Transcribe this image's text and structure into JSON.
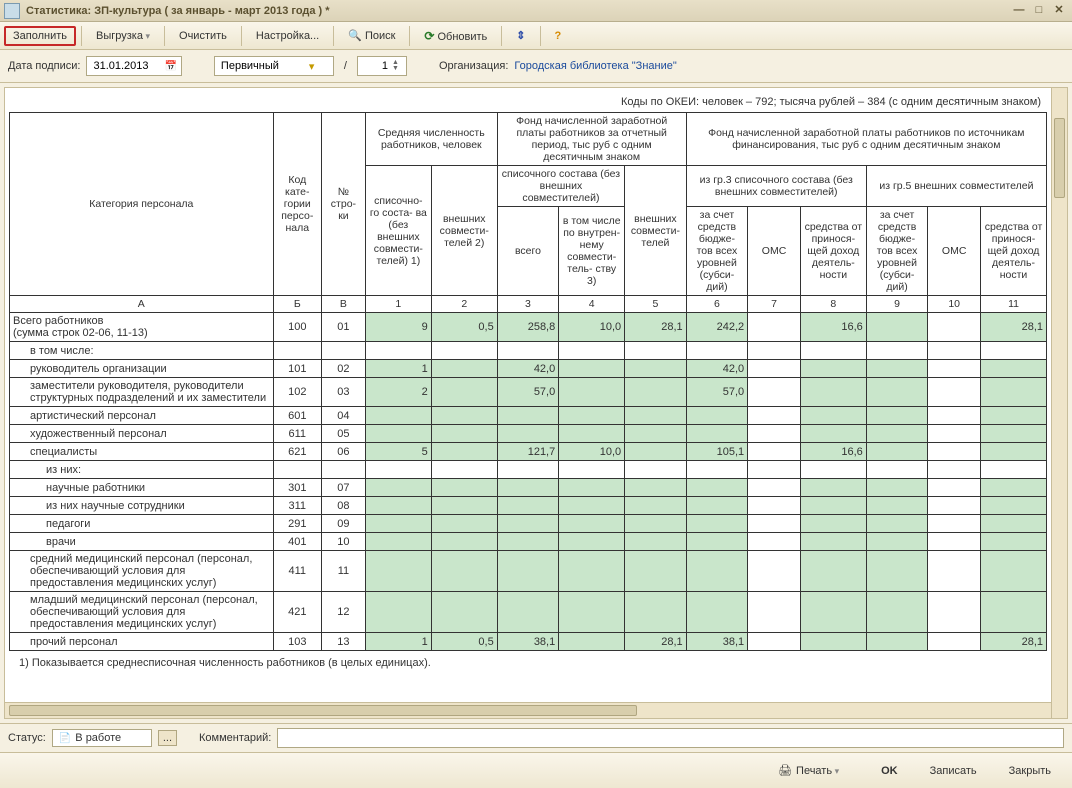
{
  "title": "Статистика: ЗП-культура ( за январь - март 2013 года ) *",
  "toolbar": {
    "fill": "Заполнить",
    "export": "Выгрузка",
    "clear": "Очистить",
    "settings": "Настройка...",
    "search": "Поиск",
    "refresh": "Обновить"
  },
  "params": {
    "dateLabel": "Дата подписи:",
    "dateValue": "31.01.2013",
    "typeValue": "Первичный",
    "numValue": "1",
    "orgLabel": "Организация:",
    "orgValue": "Городская библиотека \"Знание\""
  },
  "okei": "Коды по ОКЕИ: человек – 792; тысяча рублей – 384 (с одним десятичным знаком)",
  "headers": {
    "cat": "Категория персонала",
    "code": "Код кате-\nгории персо-\nнала",
    "rownum": "№ стро-\nки",
    "avg": "Средняя численность работников, человек",
    "fund1": "Фонд начисленной заработной платы работников за отчетный период, тыс руб\nс одним десятичным знаком",
    "fund2": "Фонд начисленной заработной платы работников по источникам финансирования, тыс руб с одним десятичным знаком",
    "col1": "списочно-\nго соста-\nва (без внешних совмести-\nтелей) 1)",
    "col2": "внешних совмести-\nтелей 2)",
    "col3g": "списочного состава (без внешних совместителей)",
    "col3": "всего",
    "col4": "в том числе по внутрен-\nнему совмести-\nтель-\nству 3)",
    "col5": "внешних совмести-\nтелей",
    "col6g": "из гр.3 списочного состава (без внешних совместителей)",
    "col6": "за счет средств бюдже-\nтов всех уровней (субси-\nдий)",
    "col7": "ОМС",
    "col8": "средства от принося-\nщей доход деятель-\nности",
    "col9g": "из гр.5 внешних совместителей",
    "col9": "за счет средств бюдже-\nтов всех уровней (субси-\nдий)",
    "col10": "ОМС",
    "col11": "средства от принося-\nщей доход деятель-\nности",
    "hA": "А",
    "hB": "Б",
    "hV": "В",
    "h1": "1",
    "h2": "2",
    "h3": "3",
    "h4": "4",
    "h5": "5",
    "h6": "6",
    "h7": "7",
    "h8": "8",
    "h9": "9",
    "h10": "10",
    "h11": "11"
  },
  "rows": [
    {
      "label": "Всего работников\n(сумма строк 02-06, 11-13)",
      "ind": 0,
      "code": "100",
      "n": "01",
      "c1": "9",
      "c2": "0,5",
      "c3": "258,8",
      "c4": "10,0",
      "c5": "28,1",
      "c6": "242,2",
      "c7": "",
      "c8": "16,6",
      "c9": "",
      "c10": "",
      "c11": "28,1"
    },
    {
      "label": "в том числе:",
      "ind": 1,
      "code": "",
      "n": "",
      "empty": true
    },
    {
      "label": "руководитель организации",
      "ind": 1,
      "code": "101",
      "n": "02",
      "c1": "1",
      "c2": "",
      "c3": "42,0",
      "c4": "",
      "c5": "",
      "c6": "42,0",
      "c7": "",
      "c8": "",
      "c9": "",
      "c10": "",
      "c11": ""
    },
    {
      "label": "заместители руководителя, руководители структурных подразделений и их заместители",
      "ind": 1,
      "code": "102",
      "n": "03",
      "c1": "2",
      "c2": "",
      "c3": "57,0",
      "c4": "",
      "c5": "",
      "c6": "57,0",
      "c7": "",
      "c8": "",
      "c9": "",
      "c10": "",
      "c11": ""
    },
    {
      "label": "артистический персонал",
      "ind": 1,
      "code": "601",
      "n": "04",
      "c1": "",
      "c2": "",
      "c3": "",
      "c4": "",
      "c5": "",
      "c6": "",
      "c7": "",
      "c8": "",
      "c9": "",
      "c10": "",
      "c11": ""
    },
    {
      "label": "художественный персонал",
      "ind": 1,
      "code": "611",
      "n": "05",
      "c1": "",
      "c2": "",
      "c3": "",
      "c4": "",
      "c5": "",
      "c6": "",
      "c7": "",
      "c8": "",
      "c9": "",
      "c10": "",
      "c11": ""
    },
    {
      "label": "специалисты",
      "ind": 1,
      "code": "621",
      "n": "06",
      "c1": "5",
      "c2": "",
      "c3": "121,7",
      "c4": "10,0",
      "c5": "",
      "c6": "105,1",
      "c7": "",
      "c8": "16,6",
      "c9": "",
      "c10": "",
      "c11": ""
    },
    {
      "label": "из них:",
      "ind": 2,
      "code": "",
      "n": "",
      "empty": true
    },
    {
      "label": "научные работники",
      "ind": 2,
      "code": "301",
      "n": "07",
      "c1": "",
      "c2": "",
      "c3": "",
      "c4": "",
      "c5": "",
      "c6": "",
      "c7": "",
      "c8": "",
      "c9": "",
      "c10": "",
      "c11": ""
    },
    {
      "label": "из них научные сотрудники",
      "ind": 2,
      "code": "311",
      "n": "08",
      "c1": "",
      "c2": "",
      "c3": "",
      "c4": "",
      "c5": "",
      "c6": "",
      "c7": "",
      "c8": "",
      "c9": "",
      "c10": "",
      "c11": ""
    },
    {
      "label": "педагоги",
      "ind": 2,
      "code": "291",
      "n": "09",
      "c1": "",
      "c2": "",
      "c3": "",
      "c4": "",
      "c5": "",
      "c6": "",
      "c7": "",
      "c8": "",
      "c9": "",
      "c10": "",
      "c11": ""
    },
    {
      "label": "врачи",
      "ind": 2,
      "code": "401",
      "n": "10",
      "c1": "",
      "c2": "",
      "c3": "",
      "c4": "",
      "c5": "",
      "c6": "",
      "c7": "",
      "c8": "",
      "c9": "",
      "c10": "",
      "c11": ""
    },
    {
      "label": "средний медицинский персонал (персонал, обеспечивающий условия для предоставления медицинских услуг)",
      "ind": 1,
      "code": "411",
      "n": "11",
      "c1": "",
      "c2": "",
      "c3": "",
      "c4": "",
      "c5": "",
      "c6": "",
      "c7": "",
      "c8": "",
      "c9": "",
      "c10": "",
      "c11": ""
    },
    {
      "label": "младший медицинский персонал (персонал, обеспечивающий условия для предоставления медицинских услуг)",
      "ind": 1,
      "code": "421",
      "n": "12",
      "c1": "",
      "c2": "",
      "c3": "",
      "c4": "",
      "c5": "",
      "c6": "",
      "c7": "",
      "c8": "",
      "c9": "",
      "c10": "",
      "c11": ""
    },
    {
      "label": "прочий персонал",
      "ind": 1,
      "code": "103",
      "n": "13",
      "c1": "1",
      "c2": "0,5",
      "c3": "38,1",
      "c4": "",
      "c5": "28,1",
      "c6": "38,1",
      "c7": "",
      "c8": "",
      "c9": "",
      "c10": "",
      "c11": "28,1"
    }
  ],
  "footnote": "1) Показывается среднесписочная численность работников (в целых единицах).",
  "status": {
    "label": "Статус:",
    "value": "В работе",
    "commentLabel": "Комментарий:"
  },
  "actions": {
    "print": "Печать",
    "ok": "OK",
    "save": "Записать",
    "close": "Закрыть"
  }
}
